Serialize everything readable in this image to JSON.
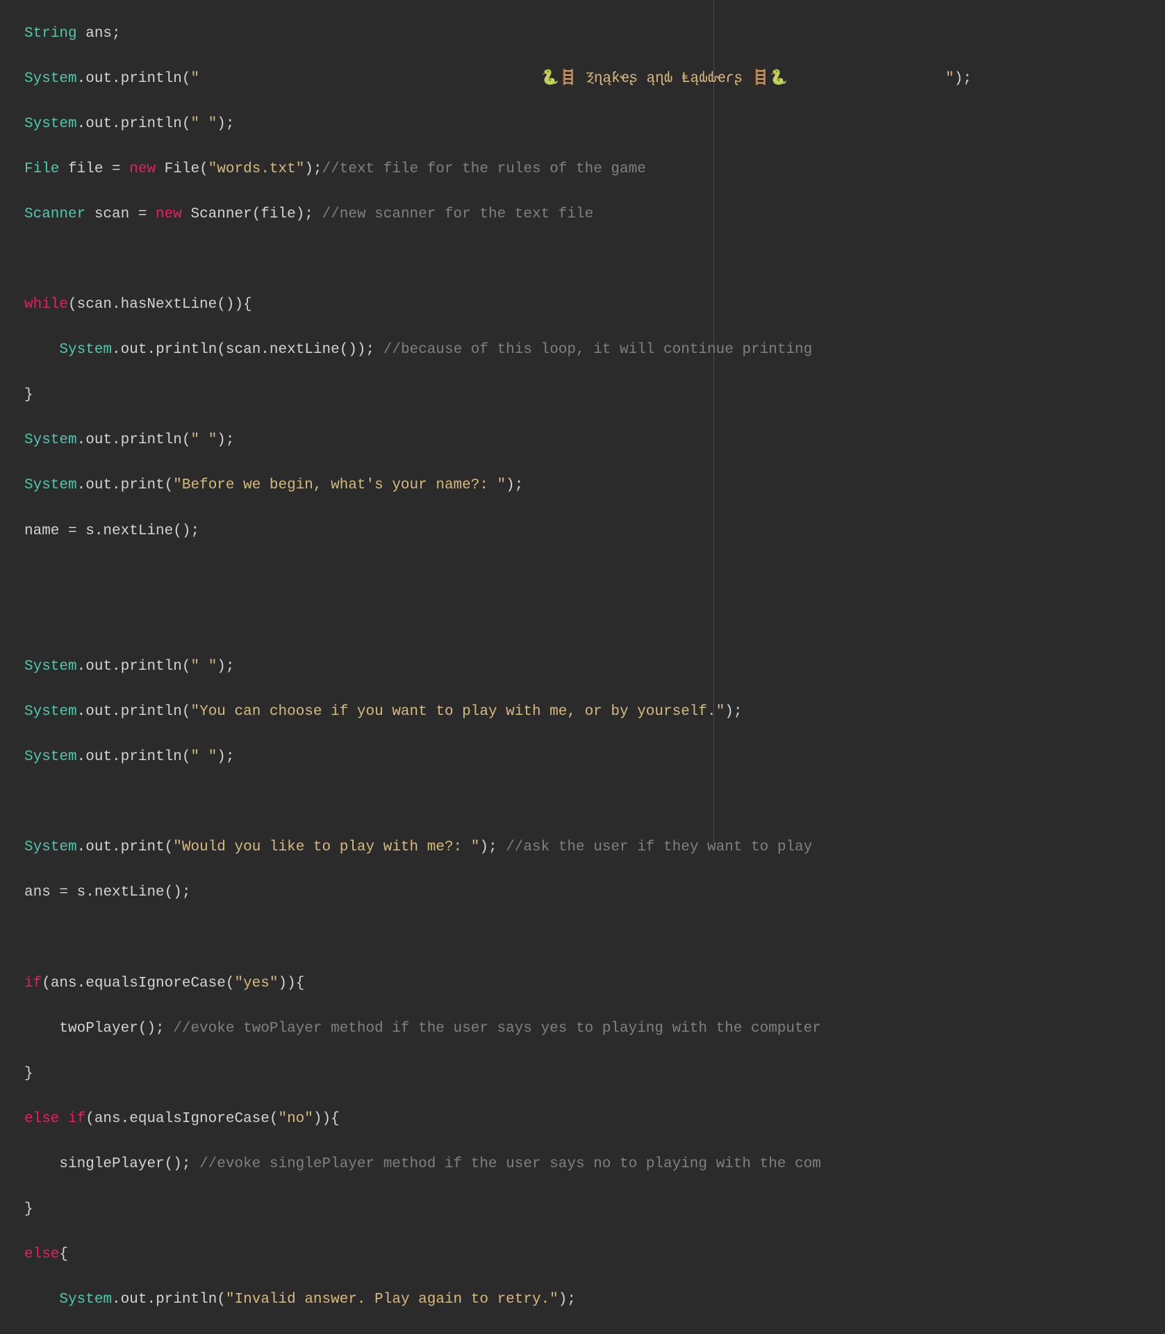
{
  "lines": {
    "l1_type": "String",
    "l1_var": " ans;",
    "l2_obj": "System",
    "l2_dot1": ".",
    "l2_out": "out",
    "l2_dot2": ".",
    "l2_method": "println",
    "l2_paren1": "(",
    "l2_str": "\"                                       🐍🪜 Ⲝɳąƙҽʂ ąɳԃ Ⱡąԃԃҽɾʂ 🪜🐍                  \"",
    "l2_paren2": ");",
    "l3_obj": "System",
    "l3_dot1": ".",
    "l3_out": "out",
    "l3_dot2": ".",
    "l3_method": "println",
    "l3_paren1": "(",
    "l3_str": "\" \"",
    "l3_paren2": ");",
    "l4_type": "File",
    "l4_var": " file ",
    "l4_eq": "=",
    "l4_new": " new ",
    "l4_ctor": "File",
    "l4_paren1": "(",
    "l4_str": "\"words.txt\"",
    "l4_paren2": ");",
    "l4_comment": "//text file for the rules of the game",
    "l5_type": "Scanner",
    "l5_var": " scan ",
    "l5_eq": "=",
    "l5_new": " new ",
    "l5_ctor": "Scanner",
    "l5_paren1": "(",
    "l5_arg": "file",
    "l5_paren2": "); ",
    "l5_comment": "//new scanner for the text file",
    "l7_while": "while",
    "l7_cond": "(scan.hasNextLine()){",
    "l8_obj": "System",
    "l8_dot1": ".",
    "l8_out": "out",
    "l8_dot2": ".",
    "l8_method": "println",
    "l8_paren1": "(scan.nextLine()); ",
    "l8_comment": "//because of this loop, it will continue printing ",
    "l9_brace": "}",
    "l10_obj": "System",
    "l10_dot1": ".",
    "l10_out": "out",
    "l10_dot2": ".",
    "l10_method": "println",
    "l10_paren1": "(",
    "l10_str": "\" \"",
    "l10_paren2": ");",
    "l11_obj": "System",
    "l11_dot1": ".",
    "l11_out": "out",
    "l11_dot2": ".",
    "l11_method": "print",
    "l11_paren1": "(",
    "l11_str": "\"Before we begin, what's your name?: \"",
    "l11_paren2": ");",
    "l12_var": "name ",
    "l12_eq": "=",
    "l12_call": " s.nextLine();",
    "l14_obj": "System",
    "l14_dot1": ".",
    "l14_out": "out",
    "l14_dot2": ".",
    "l14_method": "println",
    "l14_paren1": "(",
    "l14_str": "\" \"",
    "l14_paren2": ");",
    "l15_obj": "System",
    "l15_dot1": ".",
    "l15_out": "out",
    "l15_dot2": ".",
    "l15_method": "println",
    "l15_paren1": "(",
    "l15_str": "\"You can choose if you want to play with me, or by yourself.\"",
    "l15_paren2": ");",
    "l16_obj": "System",
    "l16_dot1": ".",
    "l16_out": "out",
    "l16_dot2": ".",
    "l16_method": "println",
    "l16_paren1": "(",
    "l16_str": "\" \"",
    "l16_paren2": ");",
    "l18_obj": "System",
    "l18_dot1": ".",
    "l18_out": "out",
    "l18_dot2": ".",
    "l18_method": "print",
    "l18_paren1": "(",
    "l18_str": "\"Would you like to play with me?: \"",
    "l18_paren2": "); ",
    "l18_comment": "//ask the user if they want to play ",
    "l19_var": "ans ",
    "l19_eq": "=",
    "l19_call": " s.nextLine();",
    "l21_if": "if",
    "l21_cond": "(ans.equalsIgnoreCase(",
    "l21_str": "\"yes\"",
    "l21_end": ")){",
    "l22_call": "twoPlayer(); ",
    "l22_comment": "//evoke twoPlayer method if the user says yes to playing with the computer",
    "l23_brace": "}",
    "l24_else": "else if",
    "l24_cond": "(ans.equalsIgnoreCase(",
    "l24_str": "\"no\"",
    "l24_end": ")){",
    "l25_call": "singlePlayer(); ",
    "l25_comment": "//evoke singlePlayer method if the user says no to playing with the com",
    "l26_brace": "}",
    "l27_else": "else",
    "l27_brace": "{",
    "l28_obj": "System",
    "l28_dot1": ".",
    "l28_out": "out",
    "l28_dot2": ".",
    "l28_method": "println",
    "l28_paren1": "(",
    "l28_str": "\"Invalid answer. Play again to retry.\"",
    "l28_paren2": ");"
  }
}
